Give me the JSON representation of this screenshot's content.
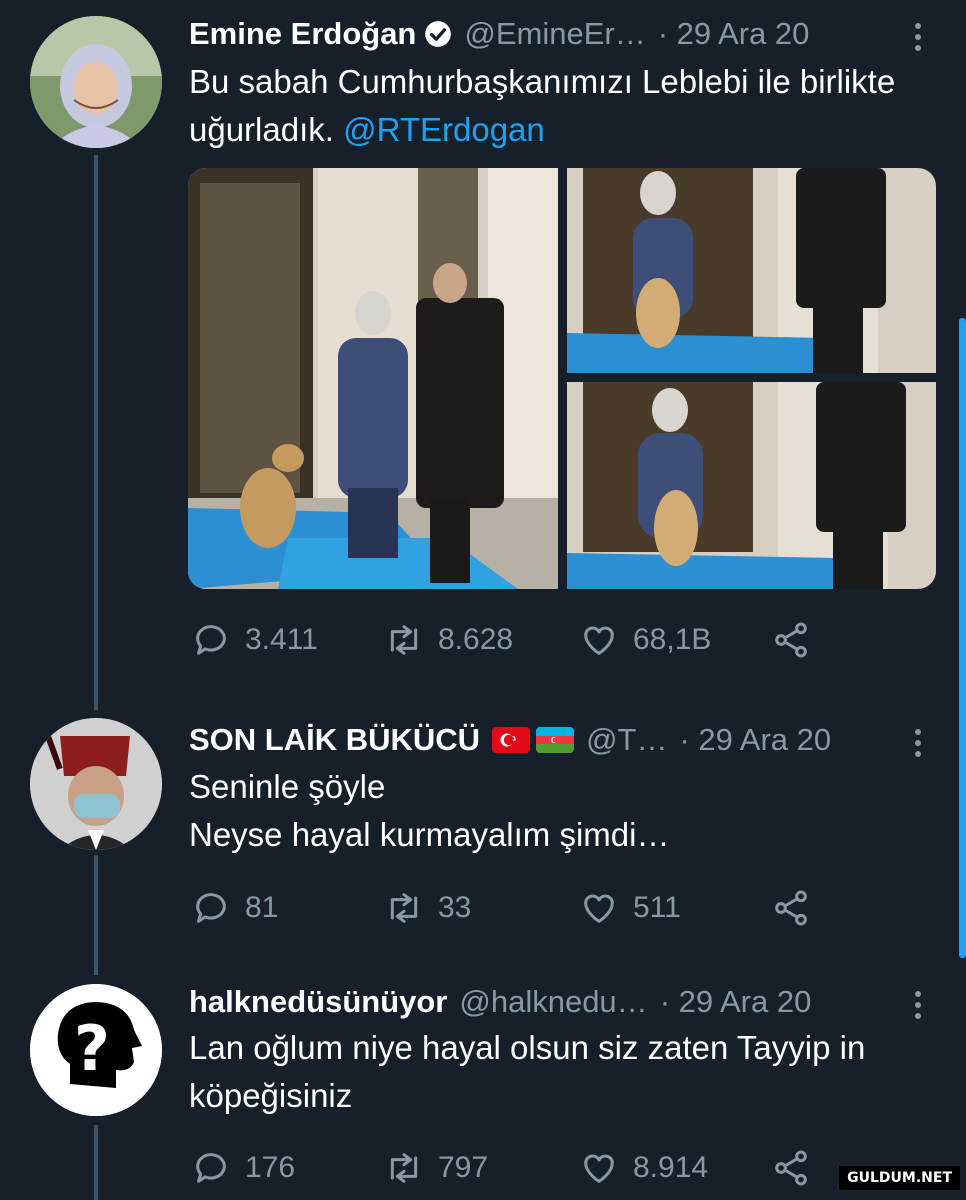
{
  "tweets": [
    {
      "name": "Emine Erdoğan",
      "handle": "@EmineEr…",
      "date": "· 29 Ara 20",
      "text": "Bu sabah Cumhurbaşkanımızı Leblebi ile birlikte uğurladık.",
      "mention": "@RTErdogan",
      "replies": "3.411",
      "retweets": "8.628",
      "likes": "68,1B"
    },
    {
      "name": "SON LAİK BÜKÜCÜ",
      "handle": "@T…",
      "date": "· 29 Ara 20",
      "line1": "Seninle şöyle",
      "line2": "Neyse hayal kurmayalım şimdi…",
      "replies": "81",
      "retweets": "33",
      "likes": "511"
    },
    {
      "name": "halknedüsünüyor",
      "handle": "@halknedu…",
      "date": "· 29 Ara 20",
      "line1": "Lan oğlum niye hayal olsun siz zaten Tayyip in",
      "line2": "köpeğisiniz",
      "replies": "176",
      "retweets": "797",
      "likes": "8.914"
    }
  ],
  "watermark": "GULDUM.NET",
  "colors": {
    "background": "#15202b",
    "secondary_text": "#8899a6",
    "accent": "#1da1f2"
  }
}
